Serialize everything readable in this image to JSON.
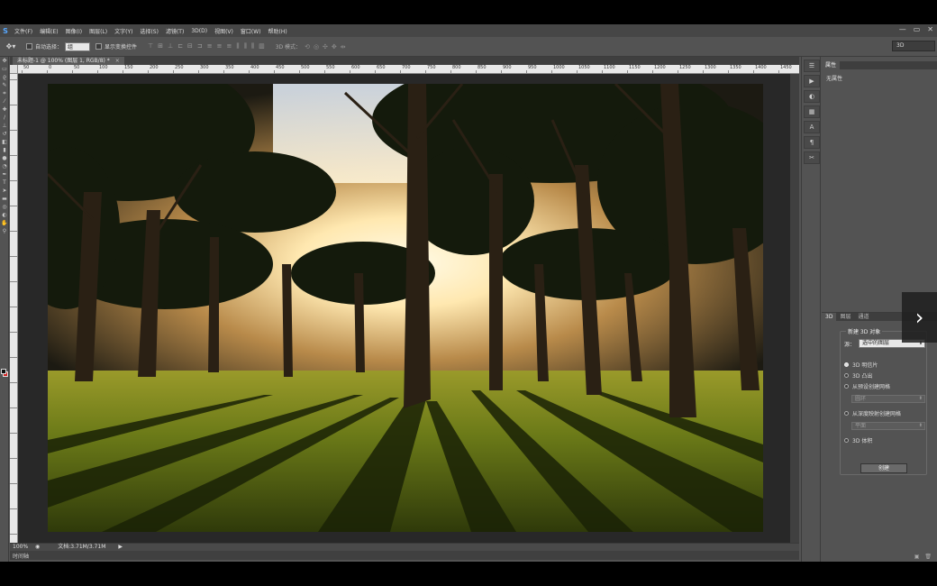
{
  "app": {
    "logo": "S"
  },
  "menu": [
    "文件(F)",
    "编辑(E)",
    "图像(I)",
    "图层(L)",
    "文字(Y)",
    "选择(S)",
    "滤镜(T)",
    "3D(D)",
    "视图(V)",
    "窗口(W)",
    "帮助(H)"
  ],
  "window_controls": [
    "—",
    "▭",
    "✕"
  ],
  "options": {
    "auto_select_label": "自动选择：",
    "auto_select_value": "组",
    "transform_label": "显示变换控件",
    "mode3d_label": "3D 模式：",
    "workspace": "3D"
  },
  "document": {
    "tab_title": "未标题-1 @ 100% (图层 1, RGB/8) *",
    "zoom": "100%",
    "doc_size": "文档:3.71M/3.71M",
    "timeline": "时间轴"
  },
  "ruler": {
    "h_ticks": [
      "50",
      "0",
      "50",
      "100",
      "150",
      "200",
      "250",
      "300",
      "350",
      "400",
      "450",
      "500",
      "550",
      "600",
      "650",
      "700",
      "750",
      "800",
      "850",
      "900",
      "950",
      "1000",
      "1050",
      "1100",
      "1150",
      "1200",
      "1250",
      "1300",
      "1350",
      "1400",
      "1450"
    ]
  },
  "properties_panel": {
    "tab": "属性",
    "empty_text": "无属性"
  },
  "panel3d": {
    "tabs": [
      "3D",
      "图层",
      "通道"
    ],
    "group_title": "新建 3D 对象",
    "source_label": "源：",
    "source_value": "选中的图层",
    "options": [
      {
        "label": "3D 明信片",
        "selected": true
      },
      {
        "label": "3D 凸出",
        "selected": false
      },
      {
        "label": "从预设创建网格",
        "selected": false
      },
      {
        "label": "从深度映射创建网格",
        "selected": false
      },
      {
        "label": "3D 体积",
        "selected": false
      }
    ],
    "preset_value": "圆环",
    "depth_value": "平面",
    "create_label": "创建"
  },
  "overlay": {
    "next_label": "›"
  }
}
